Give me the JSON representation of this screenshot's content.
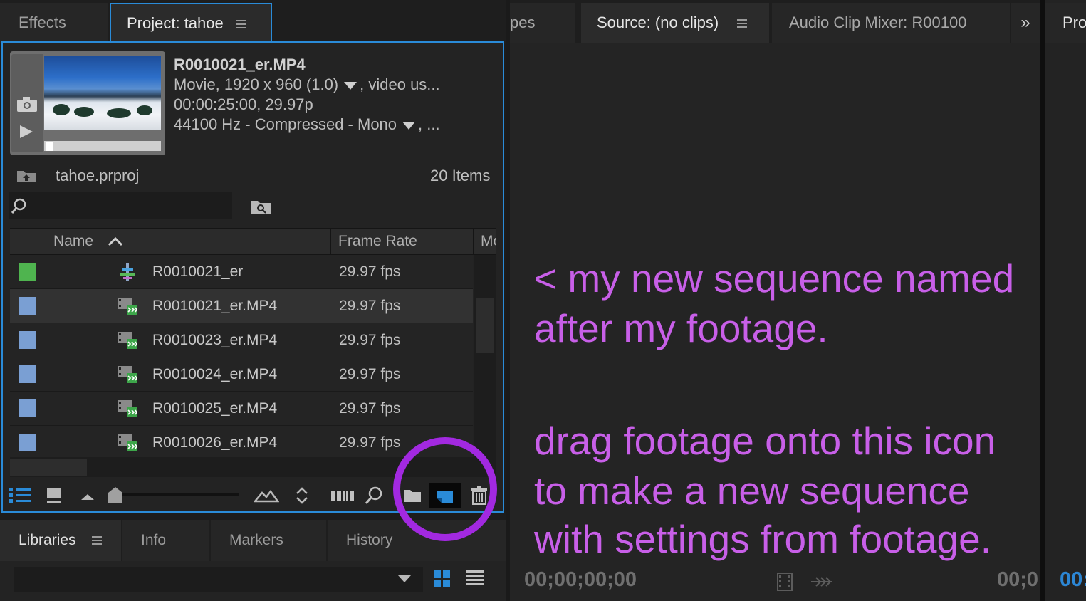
{
  "left_panel": {
    "tabs": {
      "effects": "Effects",
      "project": "Project: tahoe"
    },
    "clip_info": {
      "name": "R0010021_er.MP4",
      "video_line_a": "Movie, 1920 x 960 (1.0)",
      "video_line_b": ", video us...",
      "duration_line": "00:00:25:00, 29.97p",
      "audio_line_a": "44100 Hz - Compressed - Mono",
      "audio_line_b": ", ..."
    },
    "project_file": "tahoe.prproj",
    "items_count": "20 Items",
    "search": {
      "value": ""
    },
    "table": {
      "columns": {
        "name": "Name",
        "frame_rate": "Frame Rate",
        "more": "Mo"
      },
      "rows": [
        {
          "name": "R0010021_er",
          "fps": "29.97 fps",
          "label_color": "#4fb44f",
          "type": "sequence"
        },
        {
          "name": "R0010021_er.MP4",
          "fps": "29.97 fps",
          "label_color": "#7a9fd3",
          "type": "clip",
          "selected": true
        },
        {
          "name": "R0010023_er.MP4",
          "fps": "29.97 fps",
          "label_color": "#7a9fd3",
          "type": "clip"
        },
        {
          "name": "R0010024_er.MP4",
          "fps": "29.97 fps",
          "label_color": "#7a9fd3",
          "type": "clip"
        },
        {
          "name": "R0010025_er.MP4",
          "fps": "29.97 fps",
          "label_color": "#7a9fd3",
          "type": "clip"
        },
        {
          "name": "R0010026_er.MP4",
          "fps": "29.97 fps",
          "label_color": "#7a9fd3",
          "type": "clip"
        }
      ]
    },
    "bottom_tabs": {
      "libraries": "Libraries",
      "info": "Info",
      "markers": "Markers",
      "history": "History"
    }
  },
  "right_panel": {
    "tabs": {
      "scopes": "pes",
      "source": "Source: (no clips)",
      "mixer": "Audio Clip Mixer: R00100",
      "more": "»",
      "far": "Pro"
    },
    "timecode_left": "00;00;00;00",
    "timecode_right": "00;0",
    "timecode_far": "00:",
    "annotation": {
      "line1": "< my new sequence named",
      "line2": "after my footage.",
      "line3": "drag footage onto this icon",
      "line4": "to make a new sequence",
      "line5": "with settings from footage."
    }
  },
  "colors": {
    "accent_blue": "#2a8bd8",
    "annotation_purple": "#c85fe8",
    "highlight_ring": "#a229e0"
  }
}
